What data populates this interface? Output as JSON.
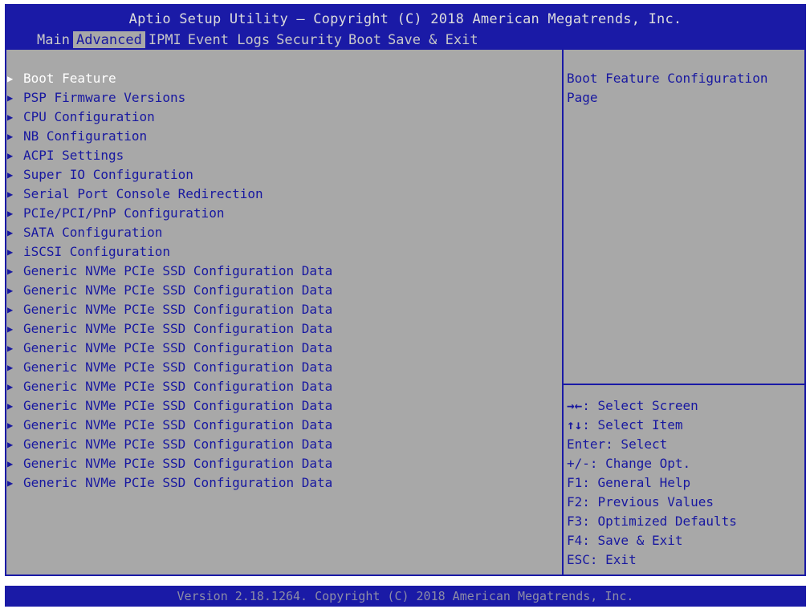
{
  "title": "Aptio Setup Utility – Copyright (C) 2018 American Megatrends, Inc.",
  "tabs": [
    "Main",
    "Advanced",
    "IPMI",
    "Event Logs",
    "Security",
    "Boot",
    "Save & Exit"
  ],
  "active_tab": "Advanced",
  "menu_items": [
    "Boot Feature",
    "PSP Firmware Versions",
    "CPU Configuration",
    "NB Configuration",
    "ACPI Settings",
    "Super IO Configuration",
    "Serial Port Console Redirection",
    "PCIe/PCI/PnP Configuration",
    "SATA Configuration",
    "iSCSI Configuration",
    "Generic NVMe PCIe SSD Configuration Data",
    "Generic NVMe PCIe SSD Configuration Data",
    "Generic NVMe PCIe SSD Configuration Data",
    "Generic NVMe PCIe SSD Configuration Data",
    "Generic NVMe PCIe SSD Configuration Data",
    "Generic NVMe PCIe SSD Configuration Data",
    "Generic NVMe PCIe SSD Configuration Data",
    "Generic NVMe PCIe SSD Configuration Data",
    "Generic NVMe PCIe SSD Configuration Data",
    "Generic NVMe PCIe SSD Configuration Data",
    "Generic NVMe PCIe SSD Configuration Data",
    "Generic NVMe PCIe SSD Configuration Data"
  ],
  "selected_item": "Boot Feature",
  "help_lines": [
    "Boot Feature Configuration",
    "Page"
  ],
  "keys": [
    {
      "sym": "→←",
      "text": ": Select Screen"
    },
    {
      "sym": "↑↓",
      "text": ": Select Item"
    },
    {
      "sym": "",
      "text": "Enter: Select"
    },
    {
      "sym": "",
      "text": "+/-: Change Opt."
    },
    {
      "sym": "",
      "text": "F1: General Help"
    },
    {
      "sym": "",
      "text": "F2: Previous Values"
    },
    {
      "sym": "",
      "text": "F3: Optimized Defaults"
    },
    {
      "sym": "",
      "text": "F4: Save & Exit"
    },
    {
      "sym": "",
      "text": "ESC: Exit"
    }
  ],
  "footer": "Version 2.18.1264. Copyright (C) 2018 American Megatrends, Inc.",
  "colors": {
    "header_blue": "#1a1aa6",
    "panel_gray": "#a8a8a8",
    "text_blue": "#1818a0",
    "selected_white": "#ffffff"
  },
  "icons": {
    "menu_arrow": "right-triangle-icon"
  }
}
